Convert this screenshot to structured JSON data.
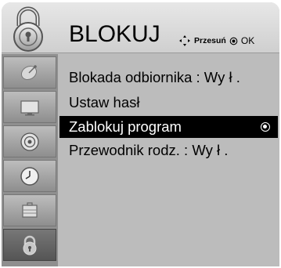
{
  "header": {
    "title": "BLOKUJ",
    "nav_hint_move": "Przesuń",
    "nav_hint_ok": "OK"
  },
  "sidebar": {
    "items": [
      {
        "icon": "satellite-dish-icon",
        "active": false
      },
      {
        "icon": "tv-screen-icon",
        "active": false
      },
      {
        "icon": "speaker-icon",
        "active": false
      },
      {
        "icon": "clock-icon",
        "active": false
      },
      {
        "icon": "toolbox-icon",
        "active": false
      },
      {
        "icon": "lock-icon",
        "active": true
      }
    ]
  },
  "menu": {
    "items": [
      {
        "label": "Blokada odbiornika   : Wy ł ."
      },
      {
        "label": "Ustaw hasł"
      },
      {
        "label": "Zablokuj program",
        "selected": true
      },
      {
        "label": "Przewodnik rodz.  : Wy ł ."
      }
    ]
  },
  "colors": {
    "header_bg": "#dcdcdc",
    "panel_bg": "#bcbcbc",
    "selected_bg": "#000000",
    "sidebar_active": "#5c5c5c"
  }
}
